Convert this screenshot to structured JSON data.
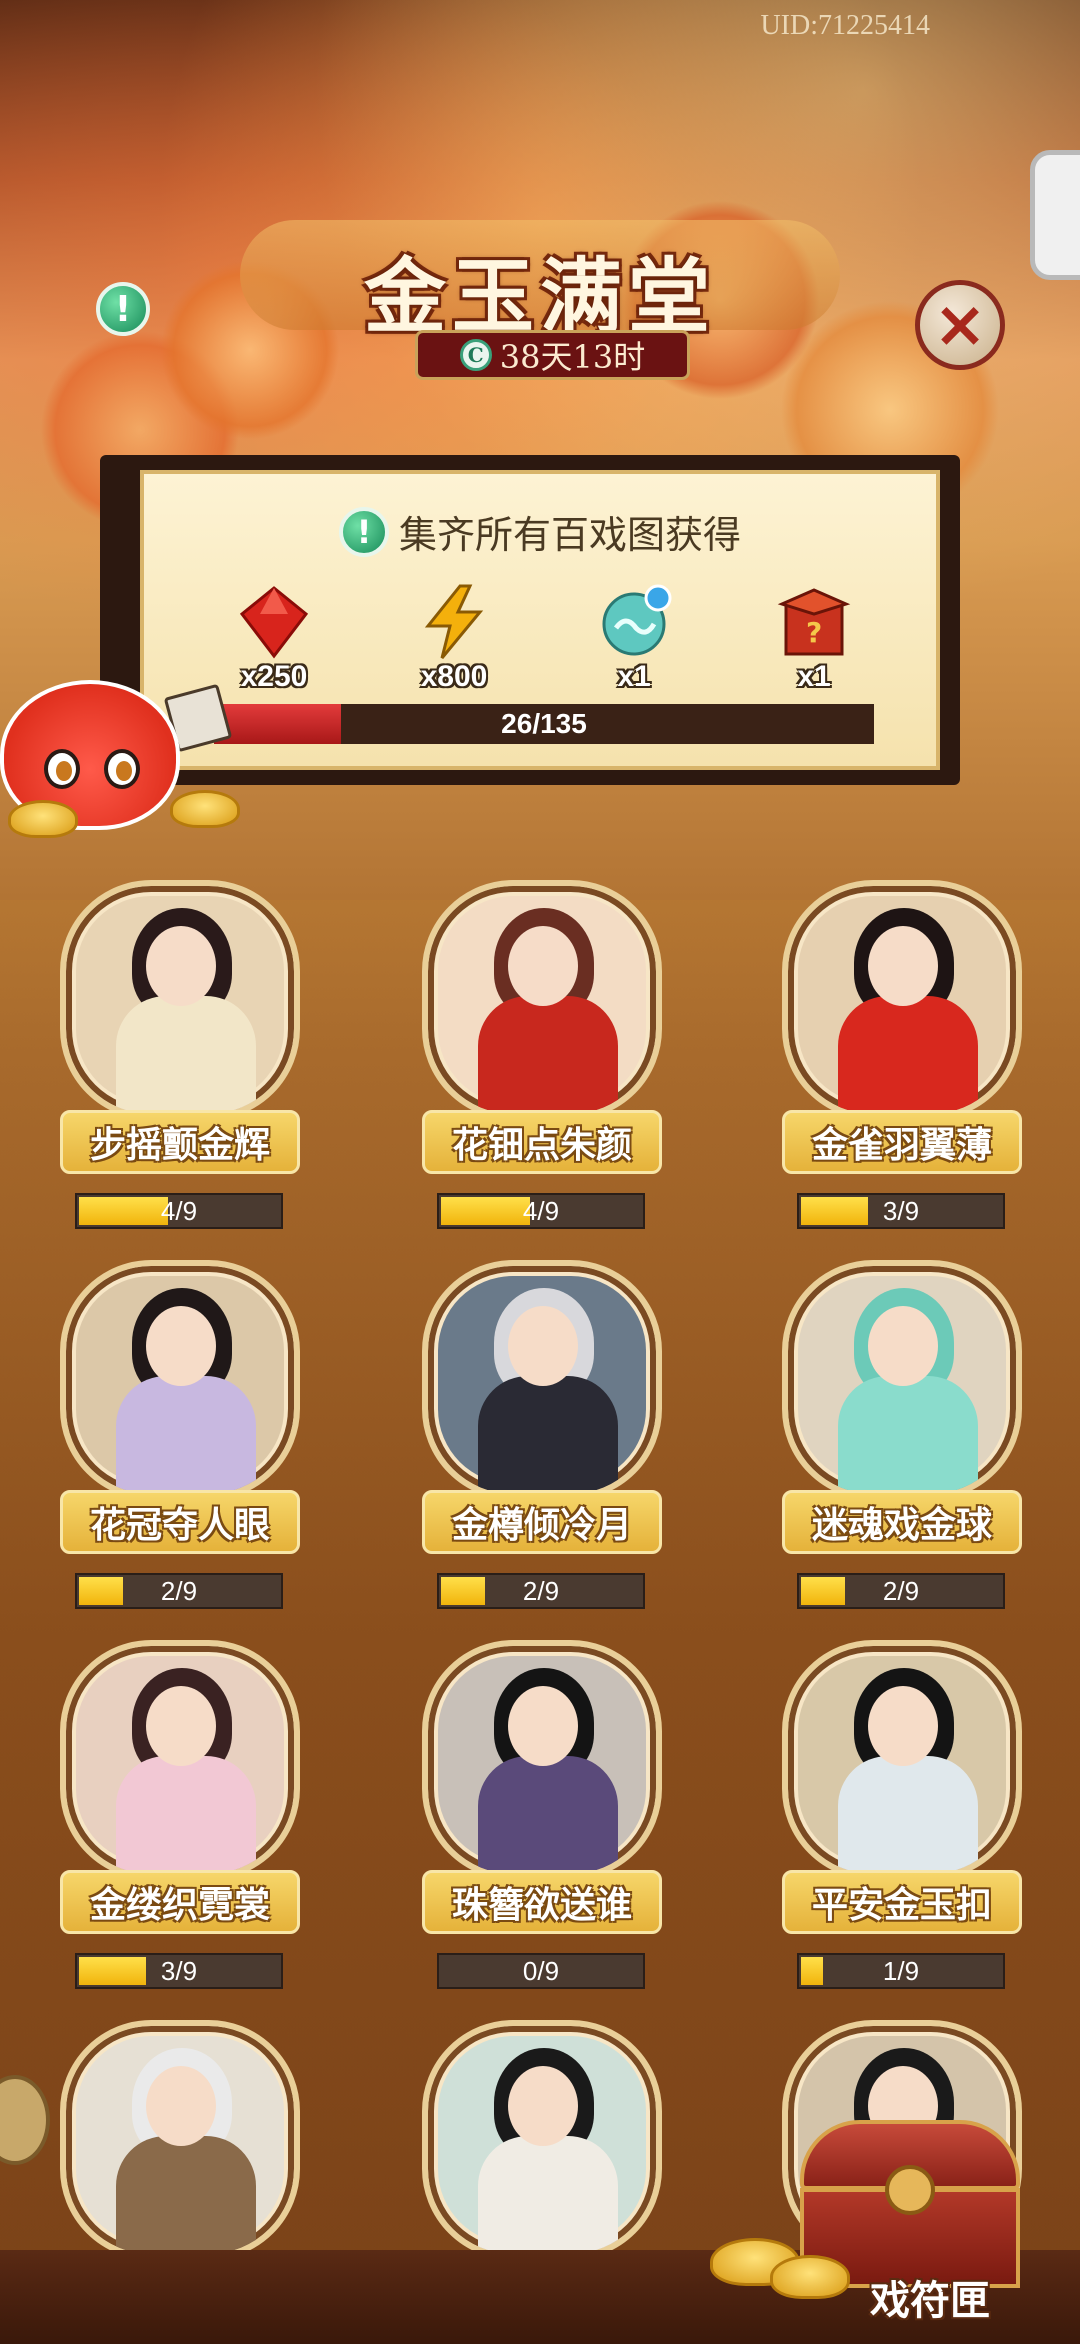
{
  "header": {
    "uid": "UID:71225414",
    "title": "金玉满堂",
    "timer": "38天13时"
  },
  "reward_panel": {
    "heading": "集齐所有百戏图获得",
    "rewards": [
      {
        "icon": "red-gem-icon",
        "count": "x250",
        "color": "#d8241c"
      },
      {
        "icon": "lightning-icon",
        "count": "x800",
        "color": "#f4b00c"
      },
      {
        "icon": "cloud-orb-icon",
        "count": "x1",
        "color": "#5ec8c0"
      },
      {
        "icon": "mystery-box-icon",
        "count": "x1",
        "color": "#c8321e"
      }
    ],
    "progress_text": "26/135",
    "progress_fraction": 0.193
  },
  "cards": [
    {
      "name": "步摇颤金辉",
      "progress": "4/9",
      "fraction": 0.444,
      "bg": "#e8d4b4",
      "hair": "#2a1a1a",
      "robe": "#f2e6c8"
    },
    {
      "name": "花钿点朱颜",
      "progress": "4/9",
      "fraction": 0.444,
      "bg": "#f3dcc4",
      "hair": "#6a2e22",
      "robe": "#c8281e"
    },
    {
      "name": "金雀羽翼薄",
      "progress": "3/9",
      "fraction": 0.333,
      "bg": "#e6d0b0",
      "hair": "#1e1414",
      "robe": "#d8281e"
    },
    {
      "name": "花冠夺人眼",
      "progress": "2/9",
      "fraction": 0.222,
      "bg": "#dcc8a8",
      "hair": "#201818",
      "robe": "#c8b8e0"
    },
    {
      "name": "金樽倾冷月",
      "progress": "2/9",
      "fraction": 0.222,
      "bg": "#6a7a8a",
      "hair": "#d8d8dc",
      "robe": "#2a2a34"
    },
    {
      "name": "迷魂戏金球",
      "progress": "2/9",
      "fraction": 0.222,
      "bg": "#e0d4c0",
      "hair": "#6ccab8",
      "robe": "#8adccc"
    },
    {
      "name": "金缕织霓裳",
      "progress": "3/9",
      "fraction": 0.333,
      "bg": "#e8d0c0",
      "hair": "#3a2222",
      "robe": "#f2c8d4"
    },
    {
      "name": "珠簪欲送谁",
      "progress": "0/9",
      "fraction": 0.0,
      "bg": "#c8c0b8",
      "hair": "#141414",
      "robe": "#5a4a7a"
    },
    {
      "name": "平安金玉扣",
      "progress": "1/9",
      "fraction": 0.111,
      "bg": "#d8c8a8",
      "hair": "#141414",
      "robe": "#e0e8ec"
    },
    {
      "name": "",
      "progress": "",
      "fraction": 0.0,
      "bg": "#e6e0d4",
      "hair": "#eaeaea",
      "robe": "#8a6a4a"
    },
    {
      "name": "",
      "progress": "",
      "fraction": 0.0,
      "bg": "#cfe0d8",
      "hair": "#1a1a1a",
      "robe": "#f0ece4"
    },
    {
      "name": "",
      "progress": "",
      "fraction": 0.0,
      "bg": "#d4c4aa",
      "hair": "#1a1a1a",
      "robe": "#4a3a2a"
    }
  ],
  "chest": {
    "label": "戏符匣"
  }
}
